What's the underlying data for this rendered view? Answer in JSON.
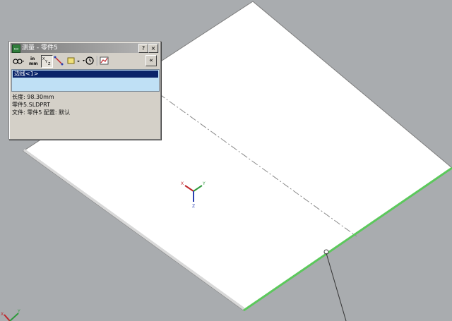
{
  "dialog": {
    "title": "测量 - 零件5",
    "title_buttons": {
      "help": "?",
      "close": "×"
    },
    "toolbar": {
      "tools": [
        {
          "name": "measure-tool",
          "label": ""
        },
        {
          "name": "units-tool",
          "label": "in mm"
        },
        {
          "name": "xyz-tool",
          "label": "XYZ"
        },
        {
          "name": "point-tool",
          "label": ""
        },
        {
          "name": "projection-tool",
          "label": ""
        },
        {
          "name": "history-tool",
          "label": ""
        },
        {
          "name": "sensor-tool",
          "label": ""
        }
      ],
      "collapse_label": "«"
    },
    "selection": {
      "items": [
        "边线<1>"
      ]
    },
    "results": {
      "length": "长度: 98.30mm",
      "file_name": "零件5.SLDPRT",
      "file_config": "文件: 零件5 配置: 默认"
    }
  },
  "viewport": {
    "triad_labels": {
      "x": "X",
      "y": "Y",
      "z": "Z"
    },
    "corner_triad_labels": {
      "x": "X",
      "y": "Y"
    },
    "colors": {
      "background": "#a9acaf",
      "plate": "#ffffff",
      "selected_edge": "#5cc85c",
      "triad_x": "#c0262b",
      "triad_y": "#2e9a3c",
      "triad_z": "#2a3fb0"
    }
  }
}
